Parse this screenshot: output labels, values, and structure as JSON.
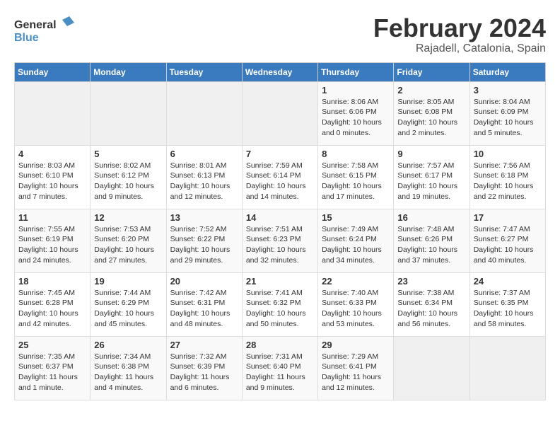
{
  "logo": {
    "text_general": "General",
    "text_blue": "Blue"
  },
  "title": "February 2024",
  "subtitle": "Rajadell, Catalonia, Spain",
  "days_of_week": [
    "Sunday",
    "Monday",
    "Tuesday",
    "Wednesday",
    "Thursday",
    "Friday",
    "Saturday"
  ],
  "weeks": [
    [
      {
        "day": "",
        "info": ""
      },
      {
        "day": "",
        "info": ""
      },
      {
        "day": "",
        "info": ""
      },
      {
        "day": "",
        "info": ""
      },
      {
        "day": "1",
        "info": "Sunrise: 8:06 AM\nSunset: 6:06 PM\nDaylight: 10 hours\nand 0 minutes."
      },
      {
        "day": "2",
        "info": "Sunrise: 8:05 AM\nSunset: 6:08 PM\nDaylight: 10 hours\nand 2 minutes."
      },
      {
        "day": "3",
        "info": "Sunrise: 8:04 AM\nSunset: 6:09 PM\nDaylight: 10 hours\nand 5 minutes."
      }
    ],
    [
      {
        "day": "4",
        "info": "Sunrise: 8:03 AM\nSunset: 6:10 PM\nDaylight: 10 hours\nand 7 minutes."
      },
      {
        "day": "5",
        "info": "Sunrise: 8:02 AM\nSunset: 6:12 PM\nDaylight: 10 hours\nand 9 minutes."
      },
      {
        "day": "6",
        "info": "Sunrise: 8:01 AM\nSunset: 6:13 PM\nDaylight: 10 hours\nand 12 minutes."
      },
      {
        "day": "7",
        "info": "Sunrise: 7:59 AM\nSunset: 6:14 PM\nDaylight: 10 hours\nand 14 minutes."
      },
      {
        "day": "8",
        "info": "Sunrise: 7:58 AM\nSunset: 6:15 PM\nDaylight: 10 hours\nand 17 minutes."
      },
      {
        "day": "9",
        "info": "Sunrise: 7:57 AM\nSunset: 6:17 PM\nDaylight: 10 hours\nand 19 minutes."
      },
      {
        "day": "10",
        "info": "Sunrise: 7:56 AM\nSunset: 6:18 PM\nDaylight: 10 hours\nand 22 minutes."
      }
    ],
    [
      {
        "day": "11",
        "info": "Sunrise: 7:55 AM\nSunset: 6:19 PM\nDaylight: 10 hours\nand 24 minutes."
      },
      {
        "day": "12",
        "info": "Sunrise: 7:53 AM\nSunset: 6:20 PM\nDaylight: 10 hours\nand 27 minutes."
      },
      {
        "day": "13",
        "info": "Sunrise: 7:52 AM\nSunset: 6:22 PM\nDaylight: 10 hours\nand 29 minutes."
      },
      {
        "day": "14",
        "info": "Sunrise: 7:51 AM\nSunset: 6:23 PM\nDaylight: 10 hours\nand 32 minutes."
      },
      {
        "day": "15",
        "info": "Sunrise: 7:49 AM\nSunset: 6:24 PM\nDaylight: 10 hours\nand 34 minutes."
      },
      {
        "day": "16",
        "info": "Sunrise: 7:48 AM\nSunset: 6:26 PM\nDaylight: 10 hours\nand 37 minutes."
      },
      {
        "day": "17",
        "info": "Sunrise: 7:47 AM\nSunset: 6:27 PM\nDaylight: 10 hours\nand 40 minutes."
      }
    ],
    [
      {
        "day": "18",
        "info": "Sunrise: 7:45 AM\nSunset: 6:28 PM\nDaylight: 10 hours\nand 42 minutes."
      },
      {
        "day": "19",
        "info": "Sunrise: 7:44 AM\nSunset: 6:29 PM\nDaylight: 10 hours\nand 45 minutes."
      },
      {
        "day": "20",
        "info": "Sunrise: 7:42 AM\nSunset: 6:31 PM\nDaylight: 10 hours\nand 48 minutes."
      },
      {
        "day": "21",
        "info": "Sunrise: 7:41 AM\nSunset: 6:32 PM\nDaylight: 10 hours\nand 50 minutes."
      },
      {
        "day": "22",
        "info": "Sunrise: 7:40 AM\nSunset: 6:33 PM\nDaylight: 10 hours\nand 53 minutes."
      },
      {
        "day": "23",
        "info": "Sunrise: 7:38 AM\nSunset: 6:34 PM\nDaylight: 10 hours\nand 56 minutes."
      },
      {
        "day": "24",
        "info": "Sunrise: 7:37 AM\nSunset: 6:35 PM\nDaylight: 10 hours\nand 58 minutes."
      }
    ],
    [
      {
        "day": "25",
        "info": "Sunrise: 7:35 AM\nSunset: 6:37 PM\nDaylight: 11 hours\nand 1 minute."
      },
      {
        "day": "26",
        "info": "Sunrise: 7:34 AM\nSunset: 6:38 PM\nDaylight: 11 hours\nand 4 minutes."
      },
      {
        "day": "27",
        "info": "Sunrise: 7:32 AM\nSunset: 6:39 PM\nDaylight: 11 hours\nand 6 minutes."
      },
      {
        "day": "28",
        "info": "Sunrise: 7:31 AM\nSunset: 6:40 PM\nDaylight: 11 hours\nand 9 minutes."
      },
      {
        "day": "29",
        "info": "Sunrise: 7:29 AM\nSunset: 6:41 PM\nDaylight: 11 hours\nand 12 minutes."
      },
      {
        "day": "",
        "info": ""
      },
      {
        "day": "",
        "info": ""
      }
    ]
  ]
}
